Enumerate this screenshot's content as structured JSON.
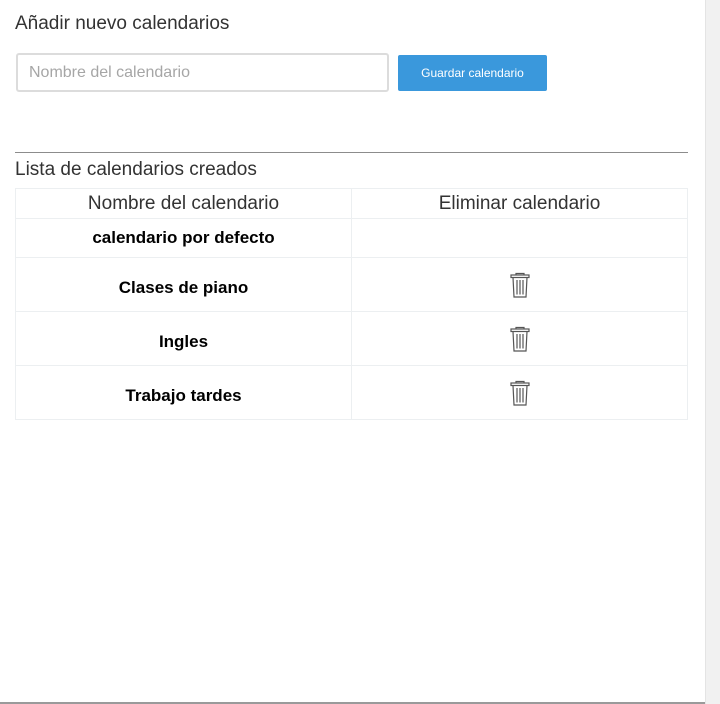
{
  "add_section": {
    "title": "Añadir nuevo calendarios",
    "input": {
      "placeholder": "Nombre del calendario",
      "value": ""
    },
    "save_label": "Guardar calendario"
  },
  "list_section": {
    "title": "Lista de calendarios creados",
    "columns": [
      "Nombre del calendario",
      "Eliminar calendario"
    ],
    "rows": [
      {
        "name": "calendario por defecto",
        "deletable": false
      },
      {
        "name": "Clases de piano",
        "deletable": true,
        "delete_icon": "trash-icon"
      },
      {
        "name": "Ingles",
        "deletable": true,
        "delete_icon": "trash-icon"
      },
      {
        "name": "Trabajo tardes",
        "deletable": true,
        "delete_icon": "trash-icon"
      }
    ]
  },
  "colors": {
    "accent": "#3a98dc",
    "text": "#333333",
    "border": "#eceff1"
  }
}
